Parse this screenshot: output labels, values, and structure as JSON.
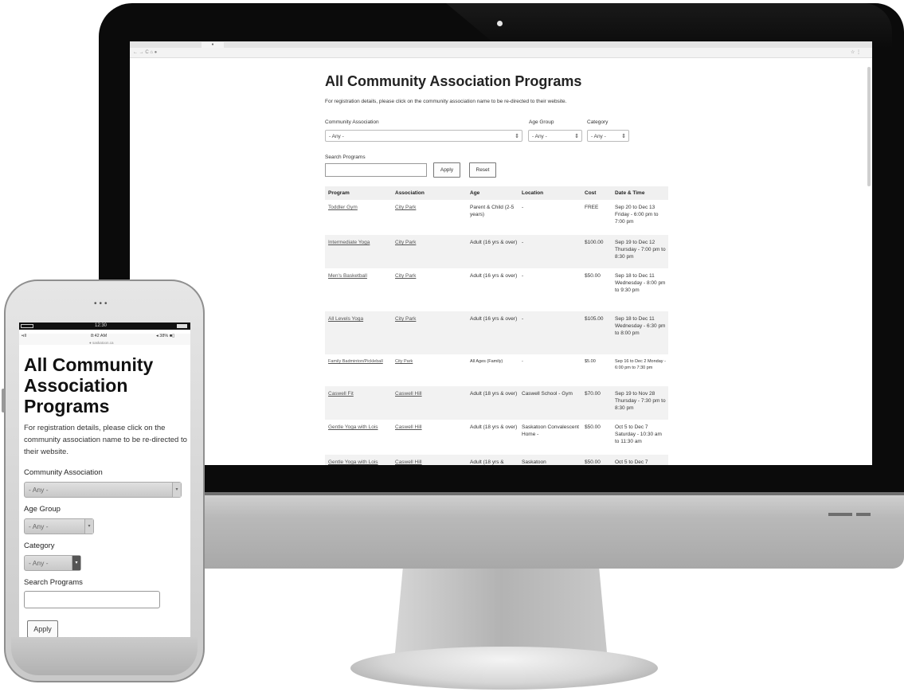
{
  "browser": {
    "tab_label": "●",
    "nav_icons": "← → C ⌂ ●",
    "menu_icons": "☆ ⋮"
  },
  "desktop": {
    "title": "All Community Association Programs",
    "intro": "For registration details, please click on the community association name to be re-directed to their website.",
    "filters": {
      "association_label": "Community Association",
      "association_value": "- Any -",
      "age_label": "Age Group",
      "age_value": "- Any -",
      "category_label": "Category",
      "category_value": "- Any -",
      "search_label": "Search Programs",
      "search_value": "",
      "apply_label": "Apply",
      "reset_label": "Reset"
    },
    "table": {
      "headers": [
        "Program",
        "Association",
        "Age",
        "Location",
        "Cost",
        "Date & Time"
      ],
      "rows": [
        {
          "program": "Toddler Gym",
          "association": "City Park",
          "age": "Parent & Child (2-5 years)",
          "location": "-",
          "cost": "FREE",
          "datetime": "Sep 20 to Dec 13 Friday - 6:00 pm to 7:00 pm"
        },
        {
          "program": "Intermediate Yoga",
          "association": "City Park",
          "age": "Adult (16 yrs & over)",
          "location": "-",
          "cost": "$100.00",
          "datetime": "Sep 19 to Dec 12 Thursday - 7:00 pm to 8:30 pm"
        },
        {
          "program": "Men's Basketball",
          "association": "City Park",
          "age": "Adult (16 yrs & over)",
          "location": "-",
          "cost": "$50.00",
          "datetime": "Sep 18 to Dec 11 Wednesday - 8:00 pm to 9:30 pm"
        },
        {
          "program": "All Levels Yoga",
          "association": "City Park",
          "age": "Adult (16 yrs & over)",
          "location": "-",
          "cost": "$105.00",
          "datetime": "Sep 18 to Dec 11 Wednesday - 6:30 pm to 8:00 pm"
        },
        {
          "program": "Family Badminton/Pickleball",
          "association": "City Park",
          "age": "All Ages (Family)",
          "location": "-",
          "cost": "$5.00",
          "datetime": "Sep 16 to Dec 2 Monday - 6:00 pm to 7:30 pm"
        },
        {
          "program": "Caswell Fit",
          "association": "Caswell Hill",
          "age": "Adult (18 yrs & over)",
          "location": "Caswell School - Gym",
          "cost": "$70.00",
          "datetime": "Sep 19 to Nov 28 Thursday - 7:30 pm to 8:30 pm"
        },
        {
          "program": "Gentle Yoga with Lois",
          "association": "Caswell Hill",
          "age": "Adult (18 yrs & over)",
          "location": "Saskatoon Convalescent Home -",
          "cost": "$50.00",
          "datetime": "Oct 5 to Dec 7 Saturday - 10:30 am to 11:30 am"
        },
        {
          "program": "Gentle Yoga with Lois",
          "association": "Caswell Hill",
          "age": "Adult (18 yrs &",
          "location": "Saskatoon",
          "cost": "$50.00",
          "datetime": "Oct 5 to Dec 7"
        }
      ]
    }
  },
  "phone": {
    "os_time": "12:30",
    "carrier": "•ıll",
    "time": "8:42 AM",
    "battery": "◂ 38% ■▯",
    "url": "● saskatoon.ca",
    "title": "All Community Association Programs",
    "intro": "For registration details, please click on the community association name to be re-directed to their website.",
    "association_label": "Community Association",
    "association_value": "- Any -",
    "age_label": "Age Group",
    "age_value": "- Any -",
    "category_label": "Category",
    "category_value": "- Any -",
    "search_label": "Search Programs",
    "apply_label": "Apply",
    "select_arrow": "▾",
    "dots": "•••"
  }
}
